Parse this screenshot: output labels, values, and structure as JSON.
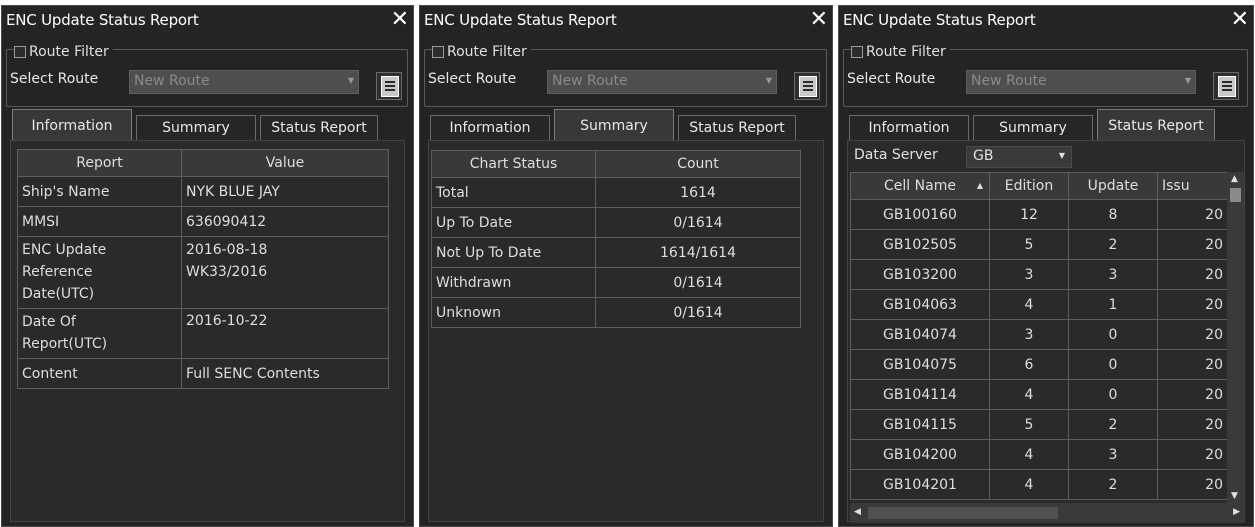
{
  "window_title": "ENC Update Status Report",
  "close_glyph": "✕",
  "route_filter": {
    "label": "Route Filter",
    "select_label": "Select Route",
    "route_value": "New Route"
  },
  "tabs": [
    "Information",
    "Summary",
    "Status Report"
  ],
  "information": {
    "headers": [
      "Report",
      "Value"
    ],
    "rows": [
      {
        "report": "Ship's Name",
        "value": "NYK BLUE JAY"
      },
      {
        "report": "MMSI",
        "value": "636090412"
      },
      {
        "report": "ENC Update\nReference\nDate(UTC)",
        "value": "2016-08-18\nWK33/2016"
      },
      {
        "report": "Date Of\nReport(UTC)",
        "value": "2016-10-22"
      },
      {
        "report": "Content",
        "value": "Full SENC Contents"
      }
    ]
  },
  "summary": {
    "headers": [
      "Chart Status",
      "Count"
    ],
    "rows": [
      {
        "status": "Total",
        "count": "1614"
      },
      {
        "status": "Up To Date",
        "count": "0/1614"
      },
      {
        "status": "Not Up To Date",
        "count": "1614/1614"
      },
      {
        "status": "Withdrawn",
        "count": "0/1614"
      },
      {
        "status": "Unknown",
        "count": "0/1614"
      }
    ]
  },
  "status_report": {
    "data_server_label": "Data Server",
    "data_server_value": "GB",
    "headers": [
      "Cell Name",
      "Edition",
      "Update",
      "Issu"
    ],
    "rows": [
      {
        "cell": "GB100160",
        "edition": "12",
        "update": "8",
        "issue": "20"
      },
      {
        "cell": "GB102505",
        "edition": "5",
        "update": "2",
        "issue": "20"
      },
      {
        "cell": "GB103200",
        "edition": "3",
        "update": "3",
        "issue": "20"
      },
      {
        "cell": "GB104063",
        "edition": "4",
        "update": "1",
        "issue": "20"
      },
      {
        "cell": "GB104074",
        "edition": "3",
        "update": "0",
        "issue": "20"
      },
      {
        "cell": "GB104075",
        "edition": "6",
        "update": "0",
        "issue": "20"
      },
      {
        "cell": "GB104114",
        "edition": "4",
        "update": "0",
        "issue": "20"
      },
      {
        "cell": "GB104115",
        "edition": "5",
        "update": "2",
        "issue": "20"
      },
      {
        "cell": "GB104200",
        "edition": "4",
        "update": "3",
        "issue": "20"
      },
      {
        "cell": "GB104201",
        "edition": "4",
        "update": "2",
        "issue": "20"
      }
    ]
  }
}
